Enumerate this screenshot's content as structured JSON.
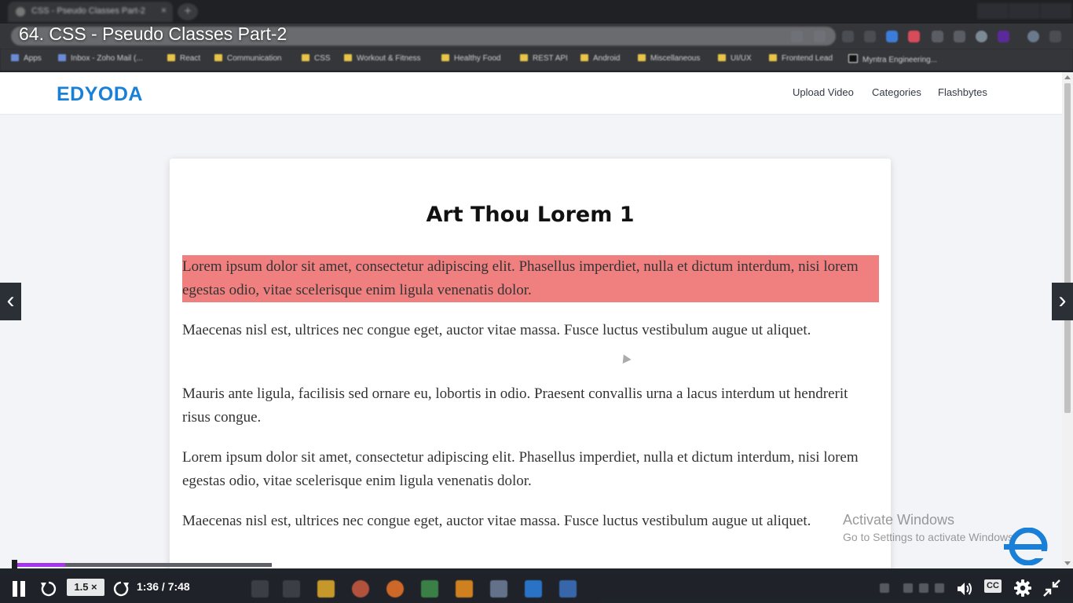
{
  "browser": {
    "tab_title": "CSS - Pseudo Classes Part-2",
    "tab_close": "×",
    "new_tab": "+",
    "bookmarks": [
      "Apps",
      "Inbox - Zoho Mail (...",
      "React",
      "Communication",
      "CSS",
      "Workout & Fitness",
      "Healthy Food",
      "REST API",
      "Android",
      "Miscellaneous",
      "UI/UX",
      "Frontend Lead",
      "Myntra Engineering..."
    ]
  },
  "video": {
    "title": "64. CSS - Pseudo Classes Part-2",
    "speed_label": "1.5 ×",
    "time": "1:36 / 7:48",
    "progress": 0.205,
    "cc_label": "CC",
    "prev_arrow": "‹",
    "next_arrow": "›"
  },
  "site": {
    "logo": "EDYODA",
    "nav": [
      "Upload Video",
      "Categories",
      "Flashbytes"
    ],
    "brand_color": "#1a7fd6"
  },
  "article": {
    "title": "Art Thou Lorem 1",
    "highlight_color": "#f08080",
    "paragraphs": [
      "Lorem ipsum dolor sit amet, consectetur adipiscing elit. Phasellus imperdiet, nulla et dictum interdum, nisi lorem egestas odio, vitae scelerisque enim ligula venenatis dolor.",
      "Maecenas nisl est, ultrices nec congue eget, auctor vitae massa. Fusce luctus vestibulum augue ut aliquet.",
      "Mauris ante ligula, facilisis sed ornare eu, lobortis in odio. Praesent convallis urna a lacus interdum ut hendrerit risus congue.",
      "Lorem ipsum dolor sit amet, consectetur adipiscing elit. Phasellus imperdiet, nulla et dictum interdum, nisi lorem egestas odio, vitae scelerisque enim ligula venenatis dolor.",
      "Maecenas nisl est, ultrices nec congue eget, auctor vitae massa. Fusce luctus vestibulum augue ut aliquet."
    ]
  },
  "watermark": {
    "title": "Activate Windows",
    "subtitle": "Go to Settings to activate Windows."
  },
  "colors": {
    "progress": "#a633f0",
    "player_bar": "#1f232a"
  }
}
